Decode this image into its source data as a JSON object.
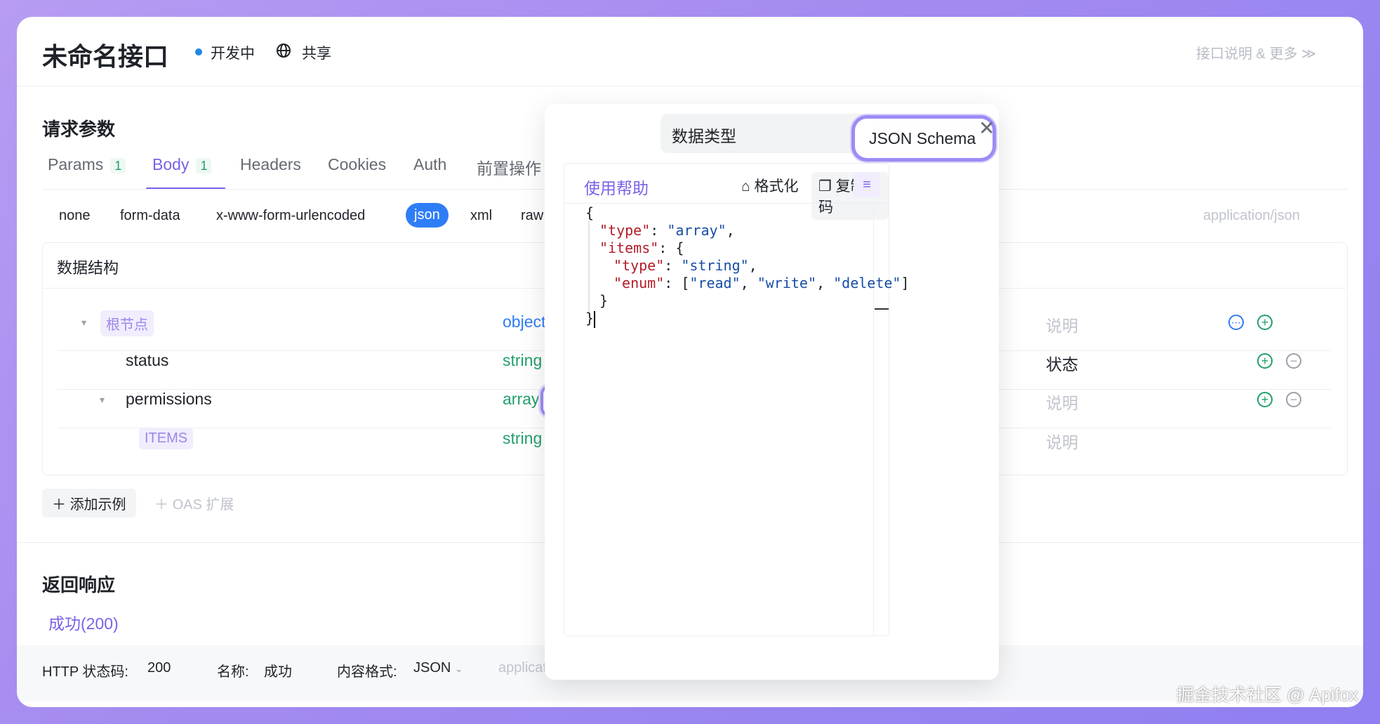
{
  "header": {
    "title": "未命名接口",
    "status": "开发中",
    "share": "共享",
    "more": "接口说明 & 更多 ≫"
  },
  "request": {
    "section_title": "请求参数",
    "tabs": [
      {
        "label": "Params",
        "count": "1"
      },
      {
        "label": "Body",
        "count": "1"
      },
      {
        "label": "Headers"
      },
      {
        "label": "Cookies"
      },
      {
        "label": "Auth"
      },
      {
        "label": "前置操作"
      }
    ],
    "body_types": [
      "none",
      "form-data",
      "x-www-form-urlencoded",
      "json",
      "xml",
      "raw"
    ],
    "content_type": "application/json",
    "structure_title": "数据结构",
    "rows": [
      {
        "name": "根节点",
        "type": "object",
        "desc": "说明"
      },
      {
        "name": "status",
        "type": "string",
        "desc": "状态"
      },
      {
        "name": "permissions",
        "type": "array",
        "desc": "说明"
      },
      {
        "name": "ITEMS",
        "type": "string",
        "desc": "说明"
      }
    ],
    "add_example": "添加示例",
    "oas_ext": "OAS 扩展"
  },
  "response": {
    "section_title": "返回响应",
    "tab": "成功(200)",
    "http_label": "HTTP 状态码:",
    "http_value": "200",
    "name_label": "名称:",
    "name_value": "成功",
    "format_label": "内容格式:",
    "format_value": "JSON",
    "content_type": "applicatio"
  },
  "modal": {
    "tab_datatype": "数据类型",
    "tab_schema": "JSON Schema",
    "help": "使用帮助",
    "format": "格式化",
    "copy": "复制代码",
    "code_lines": [
      "{",
      "\"type\": \"array\",",
      "\"items\": {",
      "\"type\": \"string\",",
      "\"enum\": [\"read\", \"write\", \"delete\"]",
      "}",
      "}"
    ]
  },
  "watermark": "掘金技术社区 @ Apifox"
}
